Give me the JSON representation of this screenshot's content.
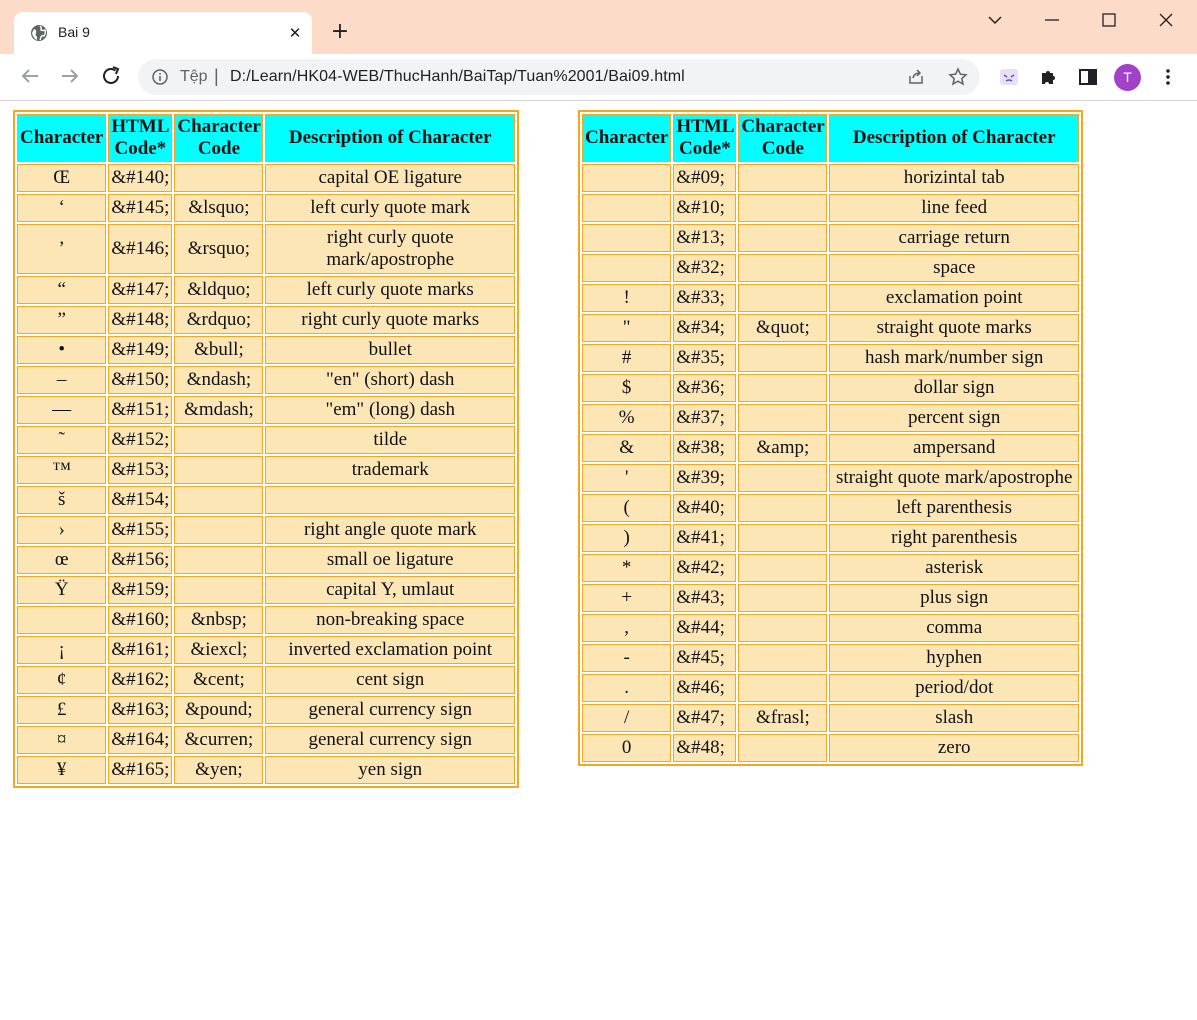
{
  "browser": {
    "tab_title": "Bai 9",
    "tab_close": "✕",
    "new_tab": "+",
    "address_prefix": "Tệp",
    "address_separator": "|",
    "url": "D:/Learn/HK04-WEB/ThucHanh/BaiTap/Tuan%2001/Bai09.html",
    "profile_initial": "T",
    "accent_avatar": "#a142c9",
    "tabbar_color": "#fcdcc8"
  },
  "tables": {
    "left": {
      "headers": [
        "Character",
        "HTML Code*",
        "Character Code",
        "Description of Character"
      ],
      "rows": [
        [
          "Œ",
          "&#140;",
          "",
          "capital OE ligature"
        ],
        [
          "‘",
          "&#145;",
          "&lsquo;",
          "left curly quote mark"
        ],
        [
          "’",
          "&#146;",
          "&rsquo;",
          "right curly quote mark/apostrophe"
        ],
        [
          "“",
          "&#147;",
          "&ldquo;",
          "left curly quote marks"
        ],
        [
          "”",
          "&#148;",
          "&rdquo;",
          "right curly quote marks"
        ],
        [
          "•",
          "&#149;",
          "&bull;",
          "bullet"
        ],
        [
          "–",
          "&#150;",
          "&ndash;",
          "\"en\" (short) dash"
        ],
        [
          "—",
          "&#151;",
          "&mdash;",
          "\"em\" (long) dash"
        ],
        [
          "˜",
          "&#152;",
          "",
          "tilde"
        ],
        [
          "™",
          "&#153;",
          "",
          "trademark"
        ],
        [
          "š",
          "&#154;",
          "",
          ""
        ],
        [
          "›",
          "&#155;",
          "",
          "right angle quote mark"
        ],
        [
          "œ",
          "&#156;",
          "",
          "small oe ligature"
        ],
        [
          "Ÿ",
          "&#159;",
          "",
          "capital Y, umlaut"
        ],
        [
          "",
          "&#160;",
          "&nbsp;",
          "non-breaking space"
        ],
        [
          "¡",
          "&#161;",
          "&iexcl;",
          "inverted exclamation point"
        ],
        [
          "¢",
          "&#162;",
          "&cent;",
          "cent sign"
        ],
        [
          "£",
          "&#163;",
          "&pound;",
          "general currency sign"
        ],
        [
          "¤",
          "&#164;",
          "&curren;",
          "general currency sign"
        ],
        [
          "¥",
          "&#165;",
          "&yen;",
          "yen sign"
        ]
      ]
    },
    "right": {
      "headers": [
        "Character",
        "HTML Code*",
        "Character Code",
        "Description of Character"
      ],
      "rows": [
        [
          "",
          "&#09;",
          "",
          "horizintal tab"
        ],
        [
          "",
          "&#10;",
          "",
          "line feed"
        ],
        [
          "",
          "&#13;",
          "",
          "carriage return"
        ],
        [
          "",
          "&#32;",
          "",
          "space"
        ],
        [
          "!",
          "&#33;",
          "",
          "exclamation point"
        ],
        [
          "\"",
          "&#34;",
          "&quot;",
          "straight quote marks"
        ],
        [
          "#",
          "&#35;",
          "",
          "hash mark/number sign"
        ],
        [
          "$",
          "&#36;",
          "",
          "dollar sign"
        ],
        [
          "%",
          "&#37;",
          "",
          "percent sign"
        ],
        [
          "&",
          "&#38;",
          "&amp;",
          "ampersand"
        ],
        [
          "'",
          "&#39;",
          "",
          "straight quote mark/apostrophe"
        ],
        [
          "(",
          "&#40;",
          "",
          "left parenthesis"
        ],
        [
          ")",
          "&#41;",
          "",
          "right parenthesis"
        ],
        [
          "*",
          "&#42;",
          "",
          "asterisk"
        ],
        [
          "+",
          "&#43;",
          "",
          "plus sign"
        ],
        [
          ",",
          "&#44;",
          "",
          "comma"
        ],
        [
          "-",
          "&#45;",
          "",
          "hyphen"
        ],
        [
          ".",
          "&#46;",
          "",
          "period/dot"
        ],
        [
          "/",
          "&#47;",
          "&frasl;",
          "slash"
        ],
        [
          "0",
          "&#48;",
          "",
          "zero"
        ]
      ]
    },
    "colors": {
      "header_bg": "#00ffff",
      "cell_bg": "#fce6b6",
      "border": "#f5a623"
    }
  }
}
